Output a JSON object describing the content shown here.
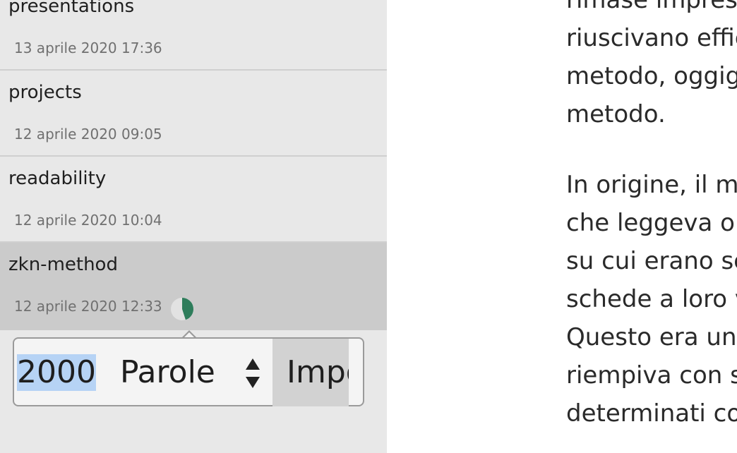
{
  "sidebar": {
    "files": [
      {
        "name": "presentations",
        "date": "13 aprile 2020 17:36"
      },
      {
        "name": "projects",
        "date": "12 aprile 2020 09:05"
      },
      {
        "name": "readability",
        "date": "12 aprile 2020 10:04"
      },
      {
        "name": "zkn-method",
        "date": "12 aprile 2020 12:33",
        "goal_progress": 0.45
      }
    ]
  },
  "goal_popover": {
    "value": "2000",
    "unit": "Parole",
    "button_label": "Impos"
  },
  "editor": {
    "paragraph1": [
      "rimase impress",
      "riuscivano effic",
      "metodo, oggigi",
      "metodo."
    ],
    "paragraph2": [
      "In origine, il me",
      "che leggeva o p",
      "su cui erano sc",
      "schede a loro v",
      "Questo era un",
      "riempiva con se",
      "determinati cor"
    ]
  },
  "colors": {
    "sidebar_bg": "#e8e8e8",
    "active_item_bg": "#cbcbcb",
    "progress_fill": "#2e7d5b",
    "selection": "#b6d3f5"
  }
}
